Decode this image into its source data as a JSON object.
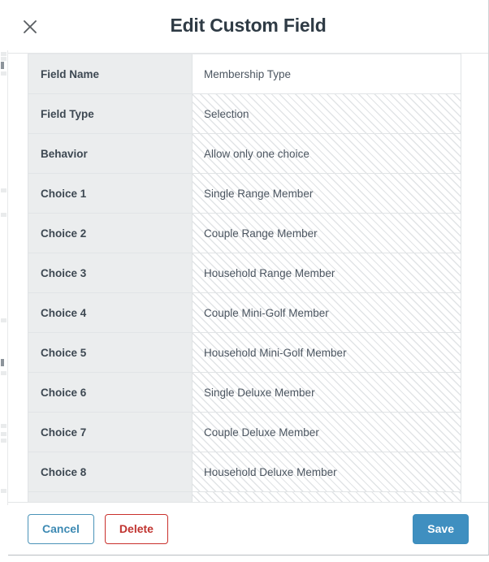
{
  "background": {
    "description": "faint underlying page visible at left edge"
  },
  "modal": {
    "title": "Edit Custom Field",
    "close_icon": "close-icon",
    "table": {
      "rows": [
        {
          "label": "Field Name",
          "value": "Membership Type",
          "readonly": false
        },
        {
          "label": "Field Type",
          "value": "Selection",
          "readonly": true
        },
        {
          "label": "Behavior",
          "value": "Allow only one choice",
          "readonly": true
        },
        {
          "label": "Choice 1",
          "value": "Single Range Member",
          "readonly": true
        },
        {
          "label": "Choice 2",
          "value": "Couple Range Member",
          "readonly": true
        },
        {
          "label": "Choice 3",
          "value": "Household Range Member",
          "readonly": true
        },
        {
          "label": "Choice 4",
          "value": "Couple Mini-Golf Member",
          "readonly": true
        },
        {
          "label": "Choice 5",
          "value": "Household Mini-Golf Member",
          "readonly": true
        },
        {
          "label": "Choice 6",
          "value": "Single Deluxe Member",
          "readonly": true
        },
        {
          "label": "Choice 7",
          "value": "Couple Deluxe Member",
          "readonly": true
        },
        {
          "label": "Choice 8",
          "value": "Household Deluxe Member",
          "readonly": true
        },
        {
          "label": "",
          "value": "",
          "readonly": true,
          "partial": true
        }
      ]
    },
    "footer": {
      "cancel_label": "Cancel",
      "delete_label": "Delete",
      "save_label": "Save"
    }
  },
  "colors": {
    "title": "#2f3b45",
    "label_bg": "#ebedee",
    "label_text": "#3d4852",
    "value_text": "#4b5560",
    "cancel_accent": "#3d8ab3",
    "delete_accent": "#c0332f",
    "save_bg": "#3f8fc0",
    "save_text": "#ffffff",
    "border": "#e1e4e6"
  }
}
